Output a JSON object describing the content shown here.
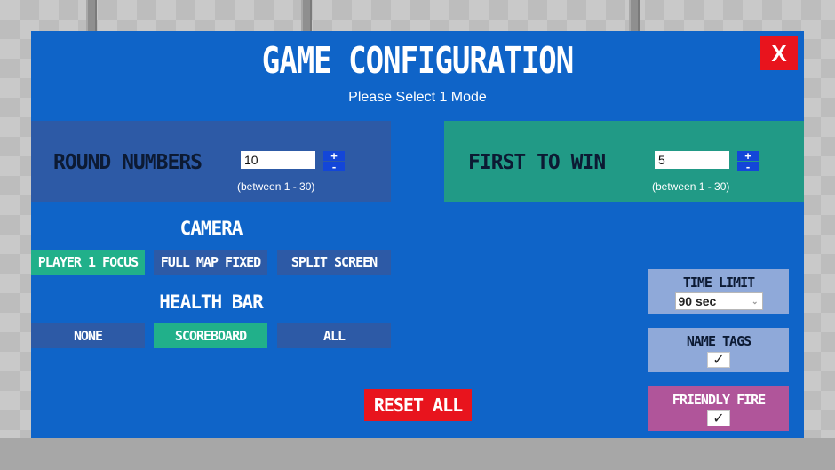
{
  "header": {
    "title": "GAME CONFIGURATION",
    "subtitle": "Please Select 1 Mode",
    "close_label": "X"
  },
  "round_numbers": {
    "label": "ROUND NUMBERS",
    "value": "10",
    "plus": "+",
    "minus": "-",
    "hint": "(between 1 - 30)"
  },
  "first_to_win": {
    "label": "FIRST TO WIN",
    "value": "5",
    "plus": "+",
    "minus": "-",
    "hint": "(between 1 - 30)"
  },
  "camera": {
    "title": "CAMERA",
    "options": [
      {
        "label": "PLAYER 1 FOCUS",
        "selected": true
      },
      {
        "label": "FULL MAP FIXED",
        "selected": false
      },
      {
        "label": "SPLIT SCREEN",
        "selected": false
      }
    ]
  },
  "health_bar": {
    "title": "HEALTH BAR",
    "options": [
      {
        "label": "NONE",
        "selected": false
      },
      {
        "label": "SCOREBOARD",
        "selected": true
      },
      {
        "label": "ALL",
        "selected": false
      }
    ]
  },
  "time_limit": {
    "label": "TIME LIMIT",
    "selected": "90 sec"
  },
  "name_tags": {
    "label": "NAME TAGS",
    "checked": true,
    "mark": "✓"
  },
  "friendly_fire": {
    "label": "FRIENDLY FIRE",
    "checked": true,
    "mark": "✓"
  },
  "reset_label": "RESET ALL",
  "colors": {
    "panel": "#0f64c8",
    "selected_option": "#21b08a",
    "option": "#2d5aa6",
    "first_to_win_box": "#219a86",
    "danger": "#e8141d",
    "friendly_fire_card": "#b0559a"
  },
  "icons": {
    "close": "close-icon",
    "checkmark": "checkmark-icon",
    "dropdown": "chevron-down-icon"
  }
}
